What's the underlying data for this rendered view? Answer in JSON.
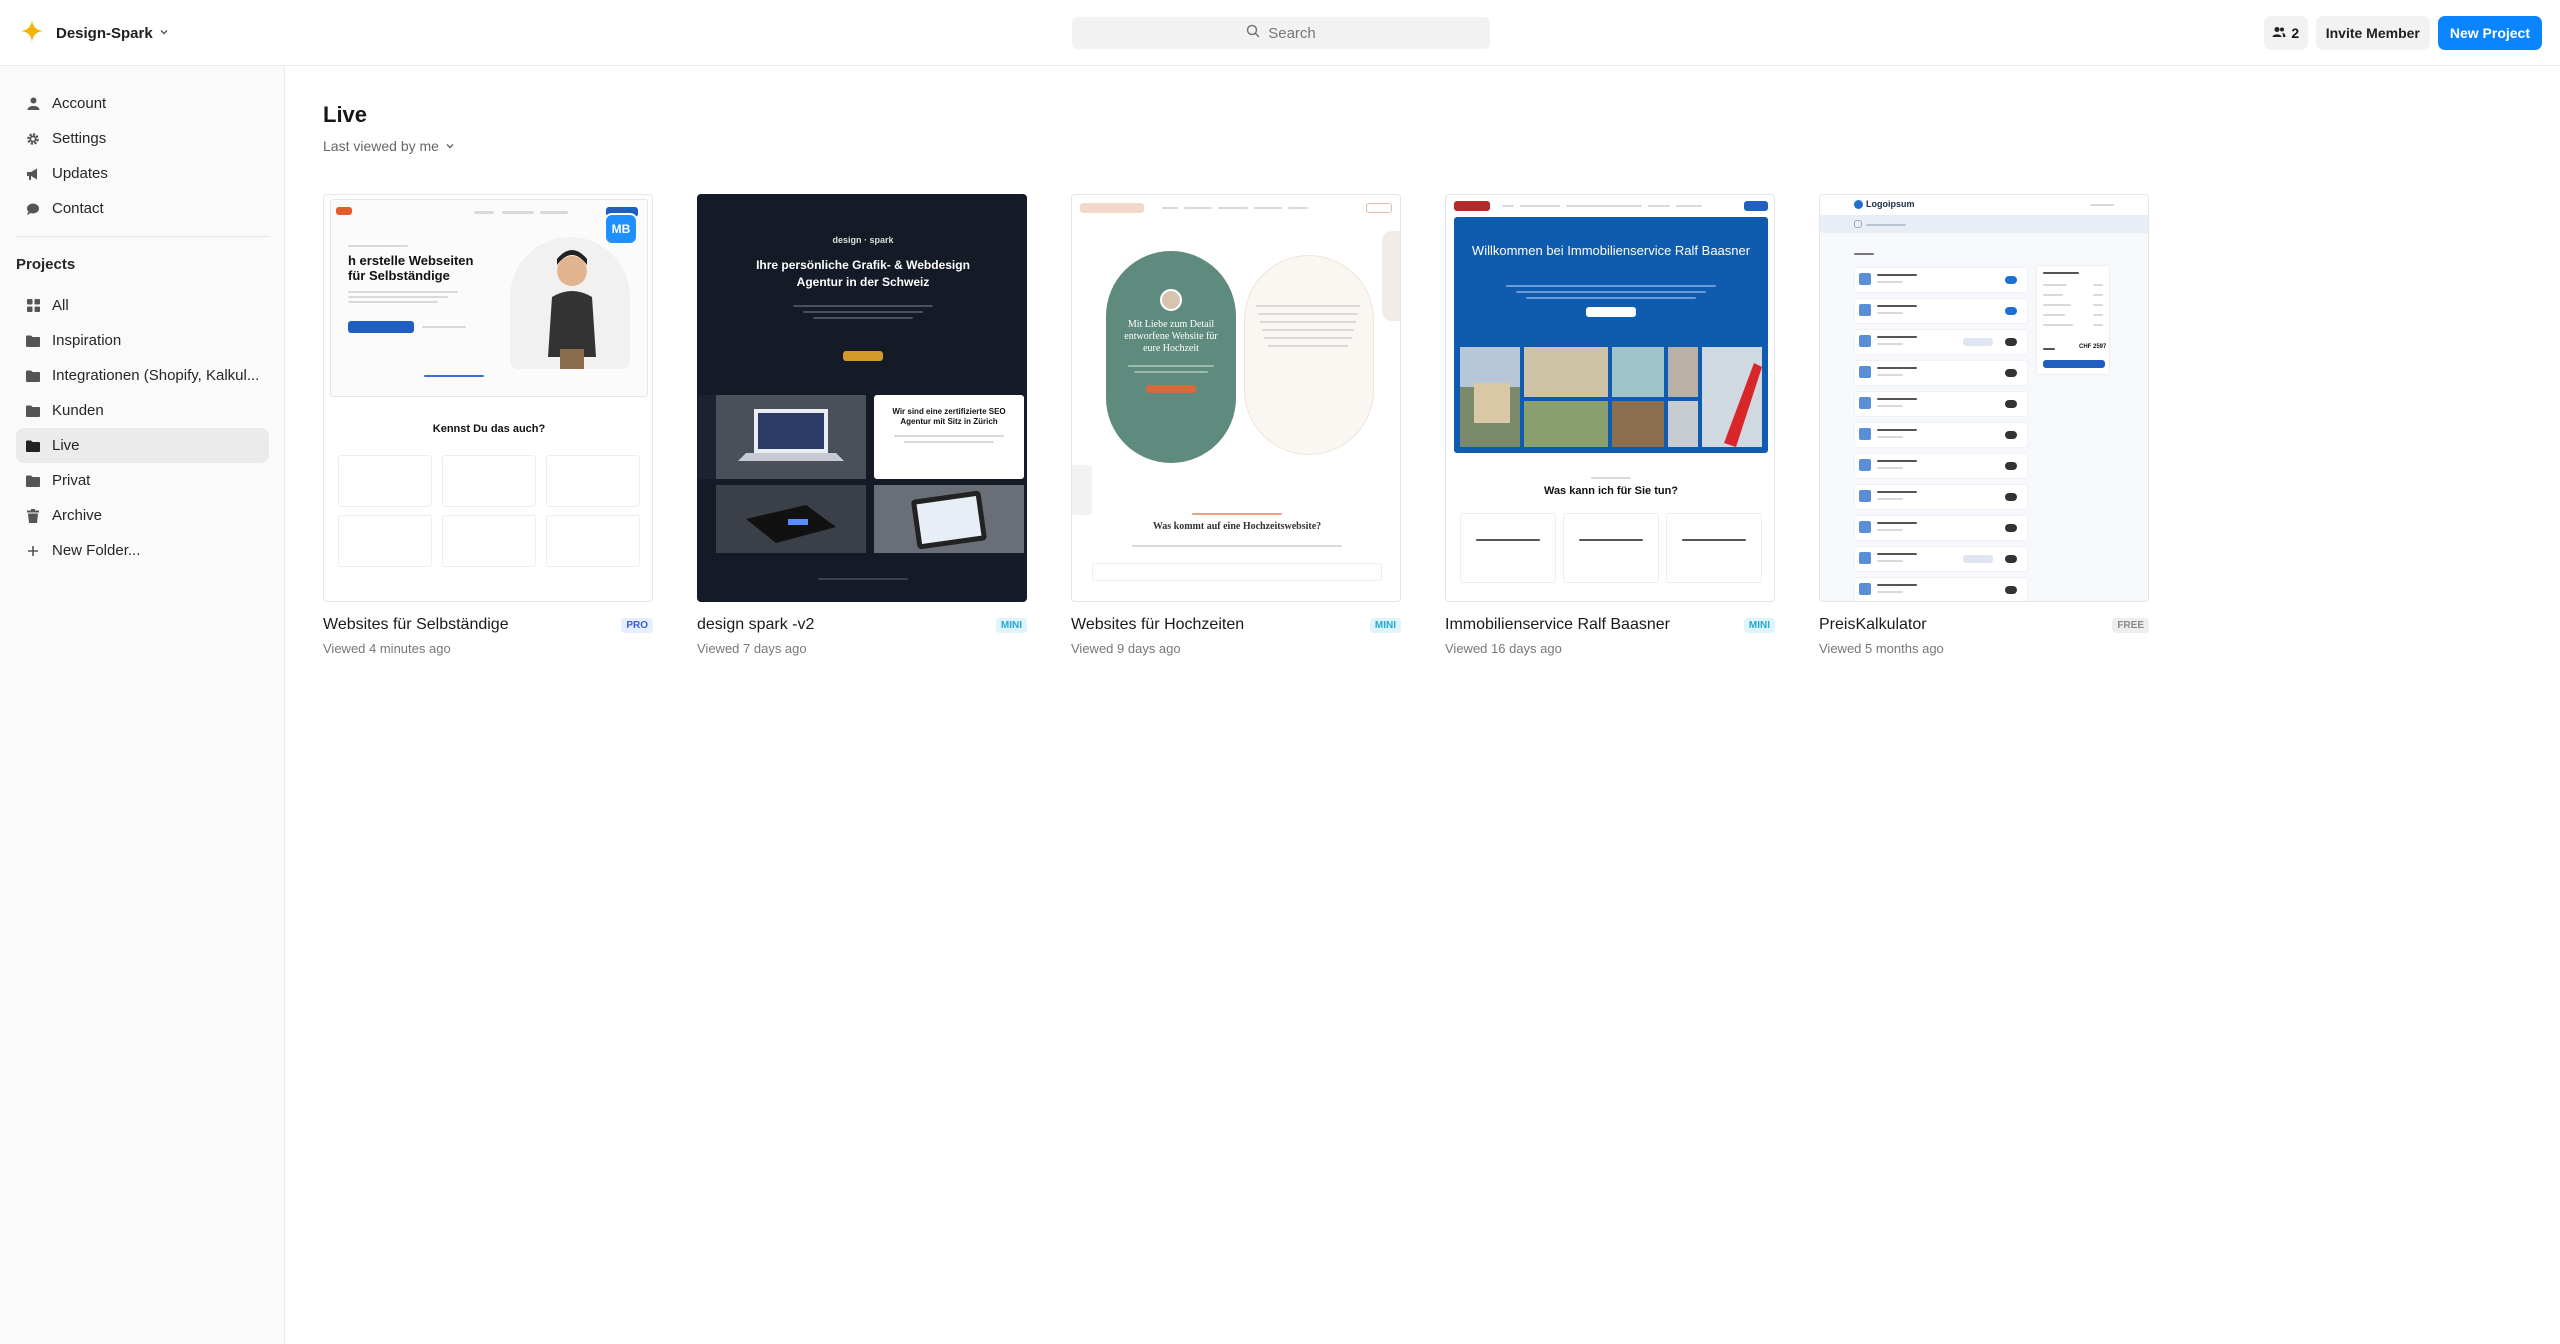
{
  "app": {
    "name": "Design-Spark"
  },
  "search": {
    "placeholder": "Search"
  },
  "header": {
    "member_count": "2",
    "invite_label": "Invite Member",
    "new_project_label": "New Project"
  },
  "sidebar": {
    "items": [
      {
        "label": "Account",
        "icon": "user-icon"
      },
      {
        "label": "Settings",
        "icon": "gear-icon"
      },
      {
        "label": "Updates",
        "icon": "megaphone-icon"
      },
      {
        "label": "Contact",
        "icon": "chat-icon"
      }
    ],
    "projects_heading": "Projects",
    "projects": [
      {
        "label": "All",
        "icon": "grid-icon"
      },
      {
        "label": "Inspiration",
        "icon": "folder-icon"
      },
      {
        "label": "Integrationen (Shopify, Kalkul...",
        "icon": "folder-icon"
      },
      {
        "label": "Kunden",
        "icon": "folder-icon"
      },
      {
        "label": "Live",
        "icon": "folder-icon",
        "active": true
      },
      {
        "label": "Privat",
        "icon": "folder-icon"
      },
      {
        "label": "Archive",
        "icon": "trash-icon"
      },
      {
        "label": "New Folder...",
        "icon": "plus-icon"
      }
    ]
  },
  "main": {
    "title": "Live",
    "sort_label": "Last viewed by me",
    "cards": [
      {
        "name": "Websites für Selbständige",
        "viewed": "Viewed 4 minutes ago",
        "badge": "PRO",
        "thumb": {
          "hero": "h erstelle Webseiten für Selbständige",
          "section": "Kennst Du das auch?",
          "avatar": "MB"
        }
      },
      {
        "name": "design spark -v2",
        "viewed": "Viewed 7 days ago",
        "badge": "MINI",
        "thumb": {
          "logo": "design · spark",
          "hero": "Ihre persönliche Grafik- & Webdesign Agentur in der Schweiz",
          "seo": "Wir sind eine zertifizierte SEO Agentur mit Sitz in Zürich"
        }
      },
      {
        "name": "Websites für Hochzeiten",
        "viewed": "Viewed 9 days ago",
        "badge": "MINI",
        "thumb": {
          "circle": "Mit Liebe zum Detail entworfene Website für eure Hochzeit",
          "section": "Was kommt auf eine Hochzeitswebsite?"
        }
      },
      {
        "name": "Immobilienservice Ralf Baasner",
        "viewed": "Viewed 16 days ago",
        "badge": "MINI",
        "thumb": {
          "hero": "Willkommen bei Immobilienservice Ralf Baasner",
          "section": "Was kann ich für Sie tun?"
        }
      },
      {
        "name": "PreisKalkulator",
        "viewed": "Viewed 5 months ago",
        "badge": "FREE",
        "thumb": {
          "logo": "Logoipsum",
          "total": "CHF 2597"
        }
      }
    ]
  },
  "colors": {
    "accent": "#0a84ff",
    "brand_star": "#f5b400"
  }
}
